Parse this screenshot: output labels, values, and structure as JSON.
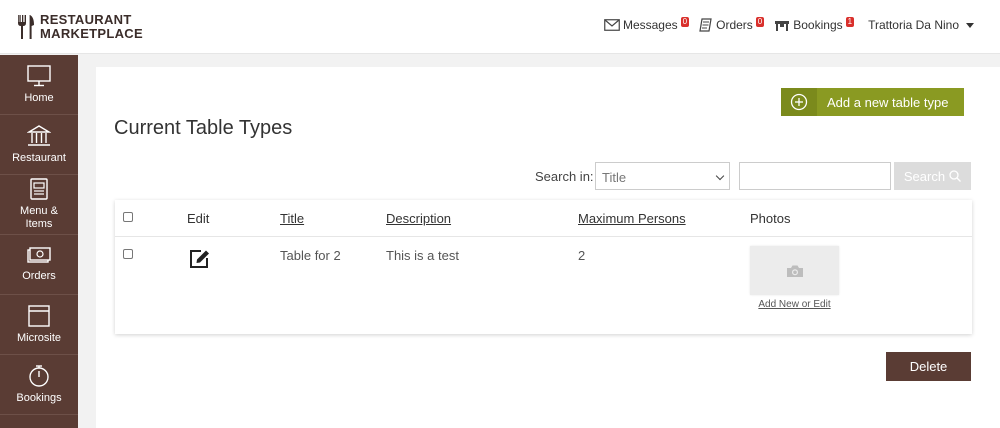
{
  "brand": {
    "line1": "RESTAURANT",
    "line2": "MARKETPLACE"
  },
  "topnav": {
    "messages_label": "Messages",
    "messages_count": "0",
    "orders_label": "Orders",
    "orders_count": "0",
    "bookings_label": "Bookings",
    "bookings_count": "1",
    "user_name": "Trattoria Da Nino"
  },
  "sidebar": {
    "items": [
      {
        "label": "Home",
        "icon": "monitor-icon"
      },
      {
        "label": "Restaurant",
        "icon": "building-icon"
      },
      {
        "label": "Menu &\nItems",
        "icon": "menu-icon"
      },
      {
        "label": "Orders",
        "icon": "cash-icon"
      },
      {
        "label": "Microsite",
        "icon": "window-icon"
      },
      {
        "label": "Bookings",
        "icon": "stopwatch-icon"
      }
    ]
  },
  "main": {
    "title": "Current Table Types",
    "add_button_label": "Add a new table type",
    "search": {
      "label": "Search in:",
      "selected_field": "Title",
      "input_value": "",
      "button_label": "Search"
    },
    "table": {
      "columns": [
        "Edit",
        "Title",
        "Description",
        "Maximum Persons",
        "Photos"
      ],
      "rows": [
        {
          "title": "Table for 2",
          "description": "This is a test",
          "max_persons": "2",
          "photo_link": "Add New or Edit"
        }
      ]
    },
    "delete_button_label": "Delete"
  },
  "colors": {
    "sidebar_bg": "#5a3c34",
    "accent_green": "#8a9a22",
    "badge_red": "#d9302c"
  }
}
